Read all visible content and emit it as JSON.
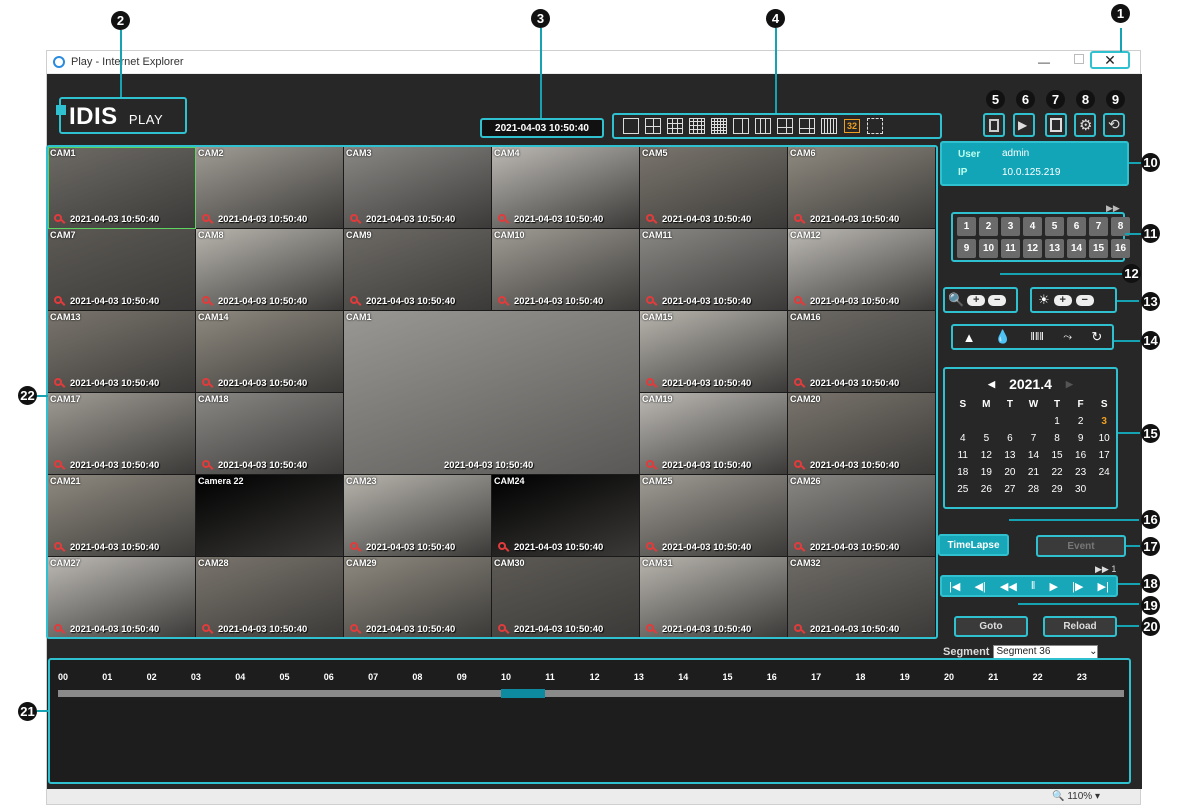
{
  "window": {
    "title": "Play - Internet Explorer"
  },
  "logo": {
    "brand": "IDIS",
    "product": "PLAY"
  },
  "datetime": "2021-04-03 10:50:40",
  "user": {
    "user_label": "User",
    "user_value": "admin",
    "ip_label": "IP",
    "ip_value": "10.0.125.219"
  },
  "layout_badge": "32",
  "channel_buttons": [
    "1",
    "2",
    "3",
    "4",
    "5",
    "6",
    "7",
    "8",
    "9",
    "10",
    "11",
    "12",
    "13",
    "14",
    "15",
    "16"
  ],
  "calendar": {
    "month": "2021.4",
    "weekdays": [
      "S",
      "M",
      "T",
      "W",
      "T",
      "F",
      "S"
    ],
    "weeks": [
      [
        "",
        "",
        "",
        "",
        "1",
        "2",
        "3"
      ],
      [
        "4",
        "5",
        "6",
        "7",
        "8",
        "9",
        "10"
      ],
      [
        "11",
        "12",
        "13",
        "14",
        "15",
        "16",
        "17"
      ],
      [
        "18",
        "19",
        "20",
        "21",
        "22",
        "23",
        "24"
      ],
      [
        "25",
        "26",
        "27",
        "28",
        "29",
        "30",
        ""
      ]
    ],
    "highlight": "3"
  },
  "modes": {
    "timelapse": "TimeLapse",
    "event": "Event"
  },
  "speed": "1",
  "actions": {
    "goto": "Goto",
    "reload": "Reload"
  },
  "segment": {
    "label": "Segment",
    "value": "Segment 36"
  },
  "timeline": {
    "hours": [
      "00",
      "01",
      "02",
      "03",
      "04",
      "05",
      "06",
      "07",
      "08",
      "09",
      "10",
      "11",
      "12",
      "13",
      "14",
      "15",
      "16",
      "17",
      "18",
      "19",
      "20",
      "21",
      "22",
      "23"
    ],
    "recorded_range_hours": [
      10,
      11
    ]
  },
  "zoom": "110%",
  "cameras": [
    {
      "name": "CAM1",
      "ts": "2021-04-03 10:50:40"
    },
    {
      "name": "CAM2",
      "ts": "2021-04-03 10:50:40"
    },
    {
      "name": "CAM3",
      "ts": "2021-04-03 10:50:40"
    },
    {
      "name": "CAM4",
      "ts": "2021-04-03 10:50:40"
    },
    {
      "name": "CAM5",
      "ts": "2021-04-03 10:50:40"
    },
    {
      "name": "CAM6",
      "ts": "2021-04-03 10:50:40"
    },
    {
      "name": "CAM7",
      "ts": "2021-04-03 10:50:40"
    },
    {
      "name": "CAM8",
      "ts": "2021-04-03 10:50:40"
    },
    {
      "name": "CAM9",
      "ts": "2021-04-03 10:50:40"
    },
    {
      "name": "CAM10",
      "ts": "2021-04-03 10:50:40"
    },
    {
      "name": "CAM11",
      "ts": "2021-04-03 10:50:40"
    },
    {
      "name": "CAM12",
      "ts": "2021-04-03 10:50:40"
    },
    {
      "name": "CAM13",
      "ts": "2021-04-03 10:50:40"
    },
    {
      "name": "CAM14",
      "ts": "2021-04-03 10:50:40"
    },
    {
      "name": "CAM1",
      "ts": "2021-04-03 10:50:40"
    },
    {
      "name": "CAM15",
      "ts": "2021-04-03 10:50:40"
    },
    {
      "name": "CAM16",
      "ts": "2021-04-03 10:50:40"
    },
    {
      "name": "CAM17",
      "ts": "2021-04-03 10:50:40"
    },
    {
      "name": "CAM18",
      "ts": "2021-04-03 10:50:40"
    },
    {
      "name": "CAM19",
      "ts": "2021-04-03 10:50:40"
    },
    {
      "name": "CAM20",
      "ts": "2021-04-03 10:50:40"
    },
    {
      "name": "CAM21",
      "ts": "2021-04-03 10:50:40"
    },
    {
      "name": "Camera 22",
      "ts": ""
    },
    {
      "name": "CAM23",
      "ts": "2021-04-03 10:50:40"
    },
    {
      "name": "CAM24",
      "ts": "2021-04-03 10:50:40"
    },
    {
      "name": "CAM25",
      "ts": "2021-04-03 10:50:40"
    },
    {
      "name": "CAM26",
      "ts": "2021-04-03 10:50:40"
    },
    {
      "name": "CAM27",
      "ts": "2021-04-03 10:50:40"
    },
    {
      "name": "CAM28",
      "ts": "2021-04-03 10:50:40"
    },
    {
      "name": "CAM29",
      "ts": "2021-04-03 10:50:40"
    },
    {
      "name": "CAM30",
      "ts": "2021-04-03 10:50:40"
    },
    {
      "name": "CAM31",
      "ts": "2021-04-03 10:50:40"
    },
    {
      "name": "CAM32",
      "ts": "2021-04-03 10:50:40"
    }
  ],
  "callouts": [
    "1",
    "2",
    "3",
    "4",
    "5",
    "6",
    "7",
    "8",
    "9",
    "10",
    "11",
    "12",
    "13",
    "14",
    "15",
    "16",
    "17",
    "18",
    "19",
    "20",
    "21",
    "22"
  ],
  "colors": {
    "accent": "#2fc1d0",
    "panel": "#272727",
    "highlight_day": "#f0a020",
    "timeline_bar": "#0e8aa0"
  }
}
